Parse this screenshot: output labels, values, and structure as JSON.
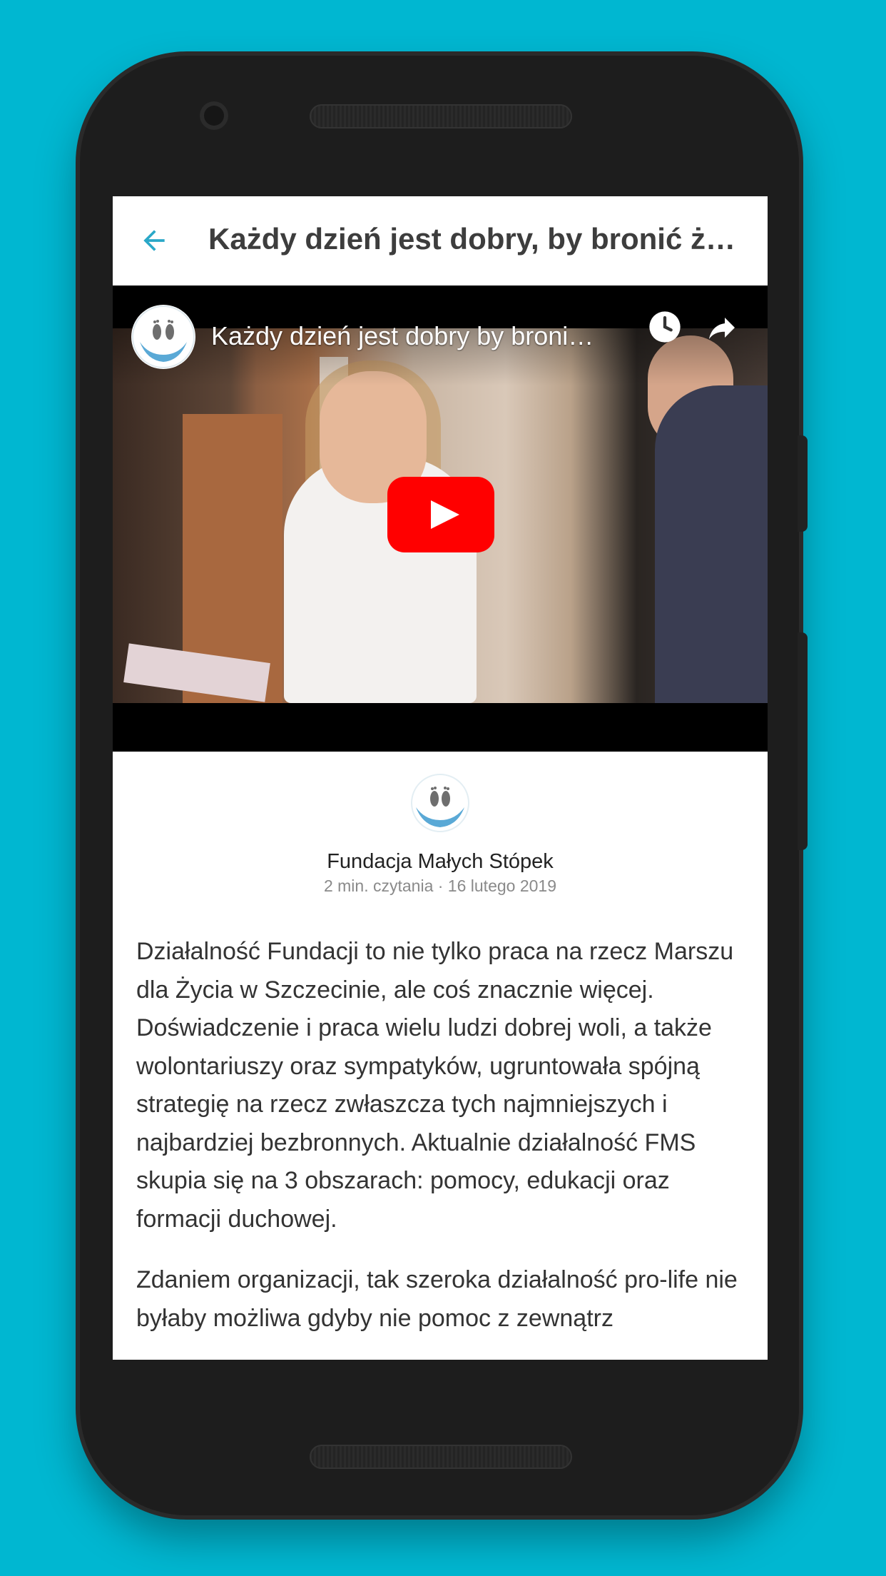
{
  "toolbar": {
    "title": "Każdy dzień jest dobry, by bronić ży…",
    "back_icon": "arrow-back-icon"
  },
  "video": {
    "title": "Każdy dzień jest dobry by broni…",
    "icons": [
      "channel-avatar-icon",
      "clock-icon",
      "share-icon",
      "play-icon"
    ]
  },
  "author": {
    "name": "Fundacja Małych Stópek",
    "meta": "2 min. czytania · 16 lutego 2019"
  },
  "article": {
    "paragraphs": [
      "Działalność Fundacji to nie tylko praca na rzecz Marszu dla Życia w Szczecinie, ale coś znacznie więcej. Doświadczenie i praca wielu ludzi dobrej woli, a także wolontariuszy oraz sympatyków, ugruntowała spójną strategię na rzecz zwłaszcza tych najmniejszych i najbardziej bezbronnych. Aktualnie działalność FMS skupia się na 3 obszarach: pomocy, edukacji oraz formacji duchowej.",
      "Zdaniem organizacji, tak szeroka działalność pro-life nie byłaby możliwa gdyby nie pomoc z zewnątrz"
    ]
  },
  "colors": {
    "background": "#00b7d1",
    "accent": "#2aa8c8",
    "youtube_red": "#ff0000"
  }
}
